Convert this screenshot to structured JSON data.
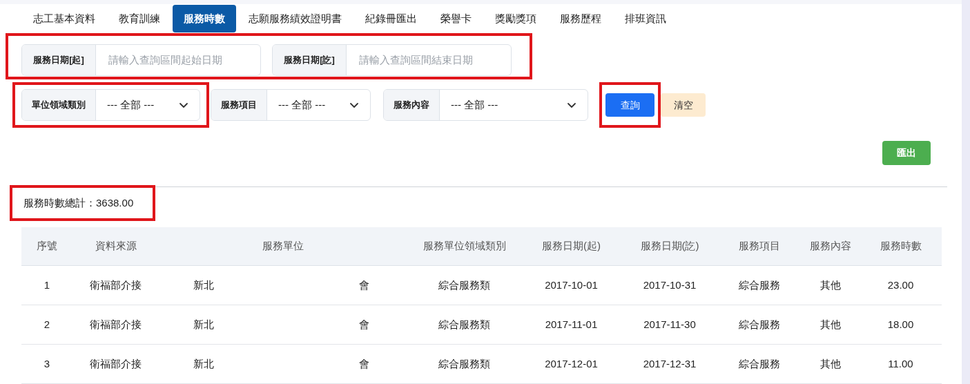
{
  "tabs": [
    {
      "label": "志工基本資料",
      "selected": false
    },
    {
      "label": "教育訓練",
      "selected": false
    },
    {
      "label": "服務時數",
      "selected": true
    },
    {
      "label": "志願服務績效證明書",
      "selected": false
    },
    {
      "label": "紀錄冊匯出",
      "selected": false
    },
    {
      "label": "榮譽卡",
      "selected": false
    },
    {
      "label": "獎勵獎項",
      "selected": false
    },
    {
      "label": "服務歷程",
      "selected": false
    },
    {
      "label": "排班資訊",
      "selected": false
    }
  ],
  "date_filters": {
    "highlighted": true,
    "fields": [
      {
        "label": "服務日期[起]",
        "placeholder": "請輸入查詢區間起始日期"
      },
      {
        "label": "服務日期[訖]",
        "placeholder": "請輸入查詢區間結束日期"
      }
    ]
  },
  "select_filters": [
    {
      "label": "單位領域類別",
      "value": "--- 全部 ---",
      "highlighted": true
    },
    {
      "label": "服務項目",
      "value": "--- 全部 ---",
      "highlighted": false
    },
    {
      "label": "服務內容",
      "value": "--- 全部 ---",
      "highlighted": false
    }
  ],
  "buttons": [
    {
      "label": "查詢",
      "kind": "primary",
      "highlighted": true
    },
    {
      "label": "清空",
      "kind": "secondary",
      "highlighted": false
    }
  ],
  "export_button": "匯出",
  "total": {
    "text": "服務時數總計：3638.00",
    "highlighted": true
  },
  "table": {
    "columns": [
      "序號",
      "資料來源",
      "服務單位",
      "服務單位領域類別",
      "服務日期(起)",
      "服務日期(訖)",
      "服務項目",
      "服務內容",
      "服務時數"
    ],
    "rows": [
      {
        "no": "1",
        "source": "衛福部介接",
        "unit_start": "新北",
        "unit_end": "會",
        "category": "綜合服務類",
        "date_from": "2017-10-01",
        "date_to": "2017-10-31",
        "item": "綜合服務",
        "content": "其他",
        "hours": "23.00"
      },
      {
        "no": "2",
        "source": "衛福部介接",
        "unit_start": "新北",
        "unit_end": "會",
        "category": "綜合服務類",
        "date_from": "2017-11-01",
        "date_to": "2017-11-30",
        "item": "綜合服務",
        "content": "其他",
        "hours": "18.00"
      },
      {
        "no": "3",
        "source": "衛福部介接",
        "unit_start": "新北",
        "unit_end": "會",
        "category": "綜合服務類",
        "date_from": "2017-12-01",
        "date_to": "2017-12-31",
        "item": "綜合服務",
        "content": "其他",
        "hours": "11.00"
      }
    ]
  }
}
